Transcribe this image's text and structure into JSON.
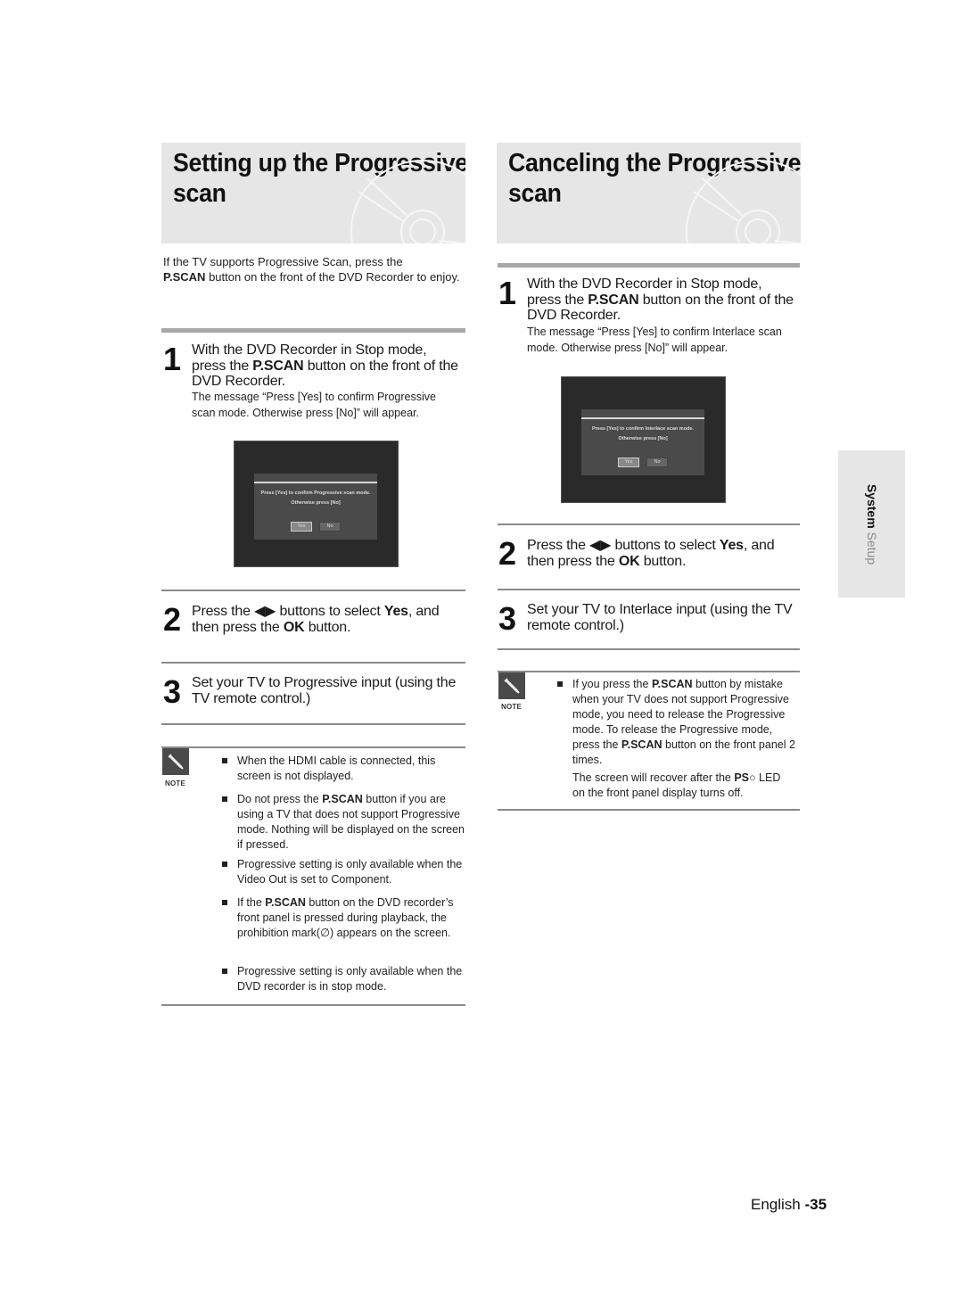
{
  "left": {
    "title_line1": "Setting up the Progressive",
    "title_line2": "scan",
    "intro_pre": "If the TV supports Progressive Scan, press the",
    "intro_bold": "P.SCAN",
    "intro_post": "button on the front of the DVD Recorder to enjoy.",
    "steps": [
      {
        "num": "1",
        "line1": "With the DVD Recorder in Stop mode,",
        "line2_pre": "press the ",
        "line2_bold": "P.SCAN",
        "line2_post": " button on the front of the",
        "line3": "DVD Recorder.",
        "sub": "The message “Press [Yes] to confirm Progressive scan mode. Otherwise press [No]” will appear."
      },
      {
        "num": "2",
        "pre": "Press the ◀▶ buttons to select ",
        "bold1": "Yes",
        "mid": ", and then press the ",
        "bold2": "OK",
        "post": " button."
      },
      {
        "num": "3",
        "text": "Set your TV to Progressive input (using the TV remote control.)"
      }
    ],
    "screen": {
      "msg1": "Press [Yes] to confirm Progressive scan mode.",
      "msg2": "Otherwise press [No]",
      "yes": "Yes",
      "no": "No"
    },
    "note_label": "NOTE",
    "notes": [
      {
        "pre": "When the HDMI cable is connected, this screen is not displayed.",
        "bold": "",
        "post": ""
      },
      {
        "pre": "Do not press the ",
        "bold": "P.SCAN",
        "post": " button if you are using a TV that does not support Progressive mode. Nothing will be displayed on the screen if pressed."
      },
      {
        "pre": "Progressive setting is only available when the Video Out is set to Component.",
        "bold": "",
        "post": ""
      },
      {
        "pre": "If the ",
        "bold": "P.SCAN",
        "post": " button on the DVD recorder’s front panel is pressed during playback, the prohibition mark(∅) appears on the screen."
      },
      {
        "pre": "Progressive setting is only available when the DVD recorder is in stop mode.",
        "bold": "",
        "post": ""
      }
    ]
  },
  "right": {
    "title_line1": "Canceling the Progressive",
    "title_line2": "scan",
    "steps": [
      {
        "num": "1",
        "line1": "With the DVD Recorder in Stop mode,",
        "line2_pre": "press the ",
        "line2_bold": "P.SCAN",
        "line2_post": " button on the front of the",
        "line3": "DVD Recorder.",
        "sub": "The message “Press [Yes] to confirm Interlace scan mode. Otherwise press [No]” will appear."
      },
      {
        "num": "2",
        "pre": "Press the ◀▶ buttons to select ",
        "bold1": "Yes",
        "mid": ", and then press the ",
        "bold2": "OK",
        "post": " button."
      },
      {
        "num": "3",
        "text": "Set your TV to Interlace input (using the TV remote control.)"
      }
    ],
    "screen": {
      "msg1": "Press [Yes] to confirm Interlace scan mode.",
      "msg2": "Otherwise press [No]",
      "yes": "Yes",
      "no": "No"
    },
    "note_label": "NOTE",
    "note": {
      "pre": "If you press the ",
      "bold1": "P.SCAN",
      "mid": " button by mistake when your TV does not support Progressive mode, you need to release the Progressive mode. To release the Progressive mode, press the ",
      "bold2": "P.SCAN",
      "post": " button on the front panel 2 times.",
      "extra_pre": "The screen will recover after the ",
      "extra_bold": "PS",
      "extra_post": "○ LED on the front panel display turns off."
    }
  },
  "side_tab": {
    "bold": "System",
    "rest": " Setup"
  },
  "footer": {
    "lang": "English ",
    "page": "-35"
  }
}
